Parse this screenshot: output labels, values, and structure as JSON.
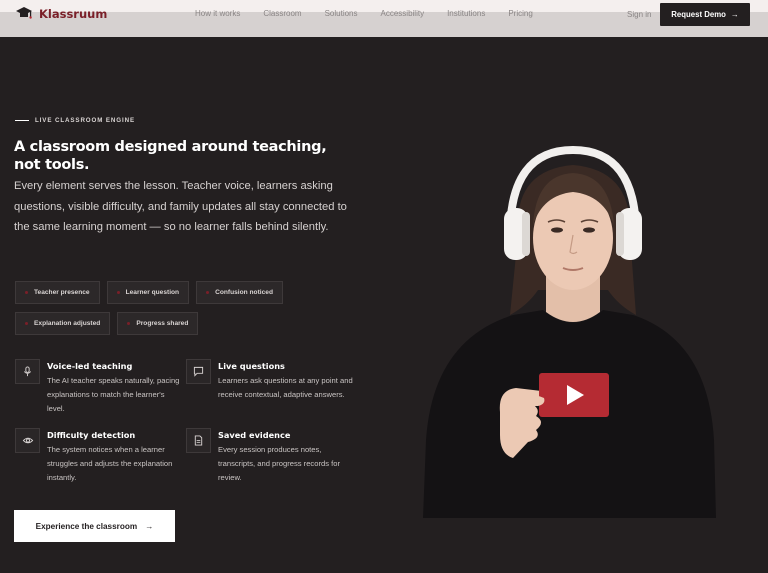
{
  "header": {
    "brand": "Klassruum",
    "nav": [
      "How it works",
      "Classroom",
      "Solutions",
      "Accessibility",
      "Institutions",
      "Pricing"
    ],
    "signin": "Sign in",
    "demo": "Request Demo"
  },
  "hero": {
    "eyebrow": "LIVE CLASSROOM ENGINE",
    "title": "A classroom designed around teaching, not tools.",
    "lead": "Every element serves the lesson. Teacher voice, learners asking questions, visible difficulty, and family updates all stay connected to the same learning moment — so no learner falls behind silently.",
    "chips": [
      "Teacher presence",
      "Learner question",
      "Confusion noticed",
      "Explanation adjusted",
      "Progress shared"
    ],
    "features": [
      {
        "title": "Voice-led teaching",
        "desc": "The AI teacher speaks naturally, pacing explanations to match the learner's level.",
        "icon": "microphone-icon"
      },
      {
        "title": "Live questions",
        "desc": "Learners ask questions at any point and receive contextual, adaptive answers.",
        "icon": "chat-icon"
      },
      {
        "title": "Difficulty detection",
        "desc": "The system notices when a learner struggles and adjusts the explanation instantly.",
        "icon": "eye-icon"
      },
      {
        "title": "Saved evidence",
        "desc": "Every session produces notes, transcripts, and progress records for review.",
        "icon": "document-icon"
      }
    ],
    "cta": "Experience the classroom"
  },
  "colors": {
    "brand": "#7a1f28",
    "background": "#231f20",
    "accent_red": "#b52b33"
  }
}
